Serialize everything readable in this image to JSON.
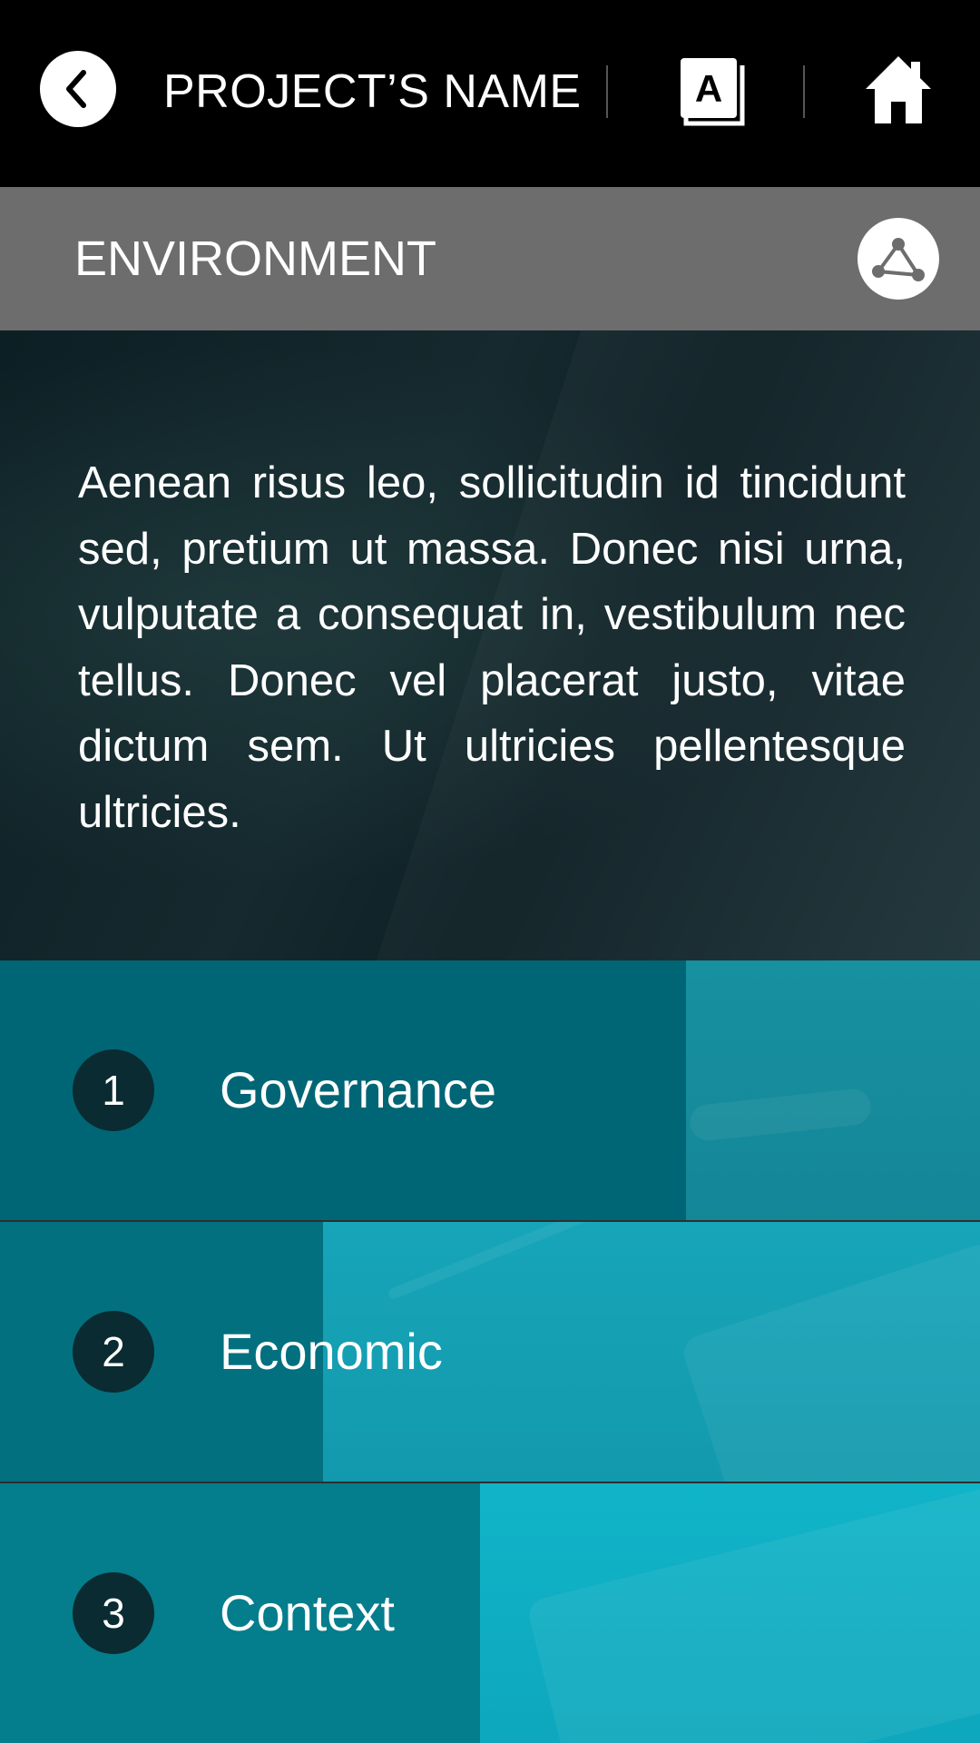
{
  "header": {
    "project_name": "PROJECT’S NAME",
    "glossary_icon_letter": "A"
  },
  "section": {
    "title": "ENVIRONMENT"
  },
  "description": "Aenean risus leo, sollicitudin id tincidunt sed, pretium ut massa. Donec nisi urna, vulputate a consequat in, vestibulum nec tellus. Donec vel placerat justo, vitae dictum sem. Ut ultricies pellentesque ultricies.",
  "menu": [
    {
      "number": "1",
      "label": "Governance",
      "progress": 0.7
    },
    {
      "number": "2",
      "label": "Economic",
      "progress": 0.33
    },
    {
      "number": "3",
      "label": "Context",
      "progress": 0.49
    }
  ],
  "colors": {
    "topbar": "#000000",
    "section_header": "#6d6d6d",
    "hero": "#15292e",
    "row_dark": "#006675",
    "row_accent": "#10b4c8",
    "number_badge": "#0a2b31"
  }
}
